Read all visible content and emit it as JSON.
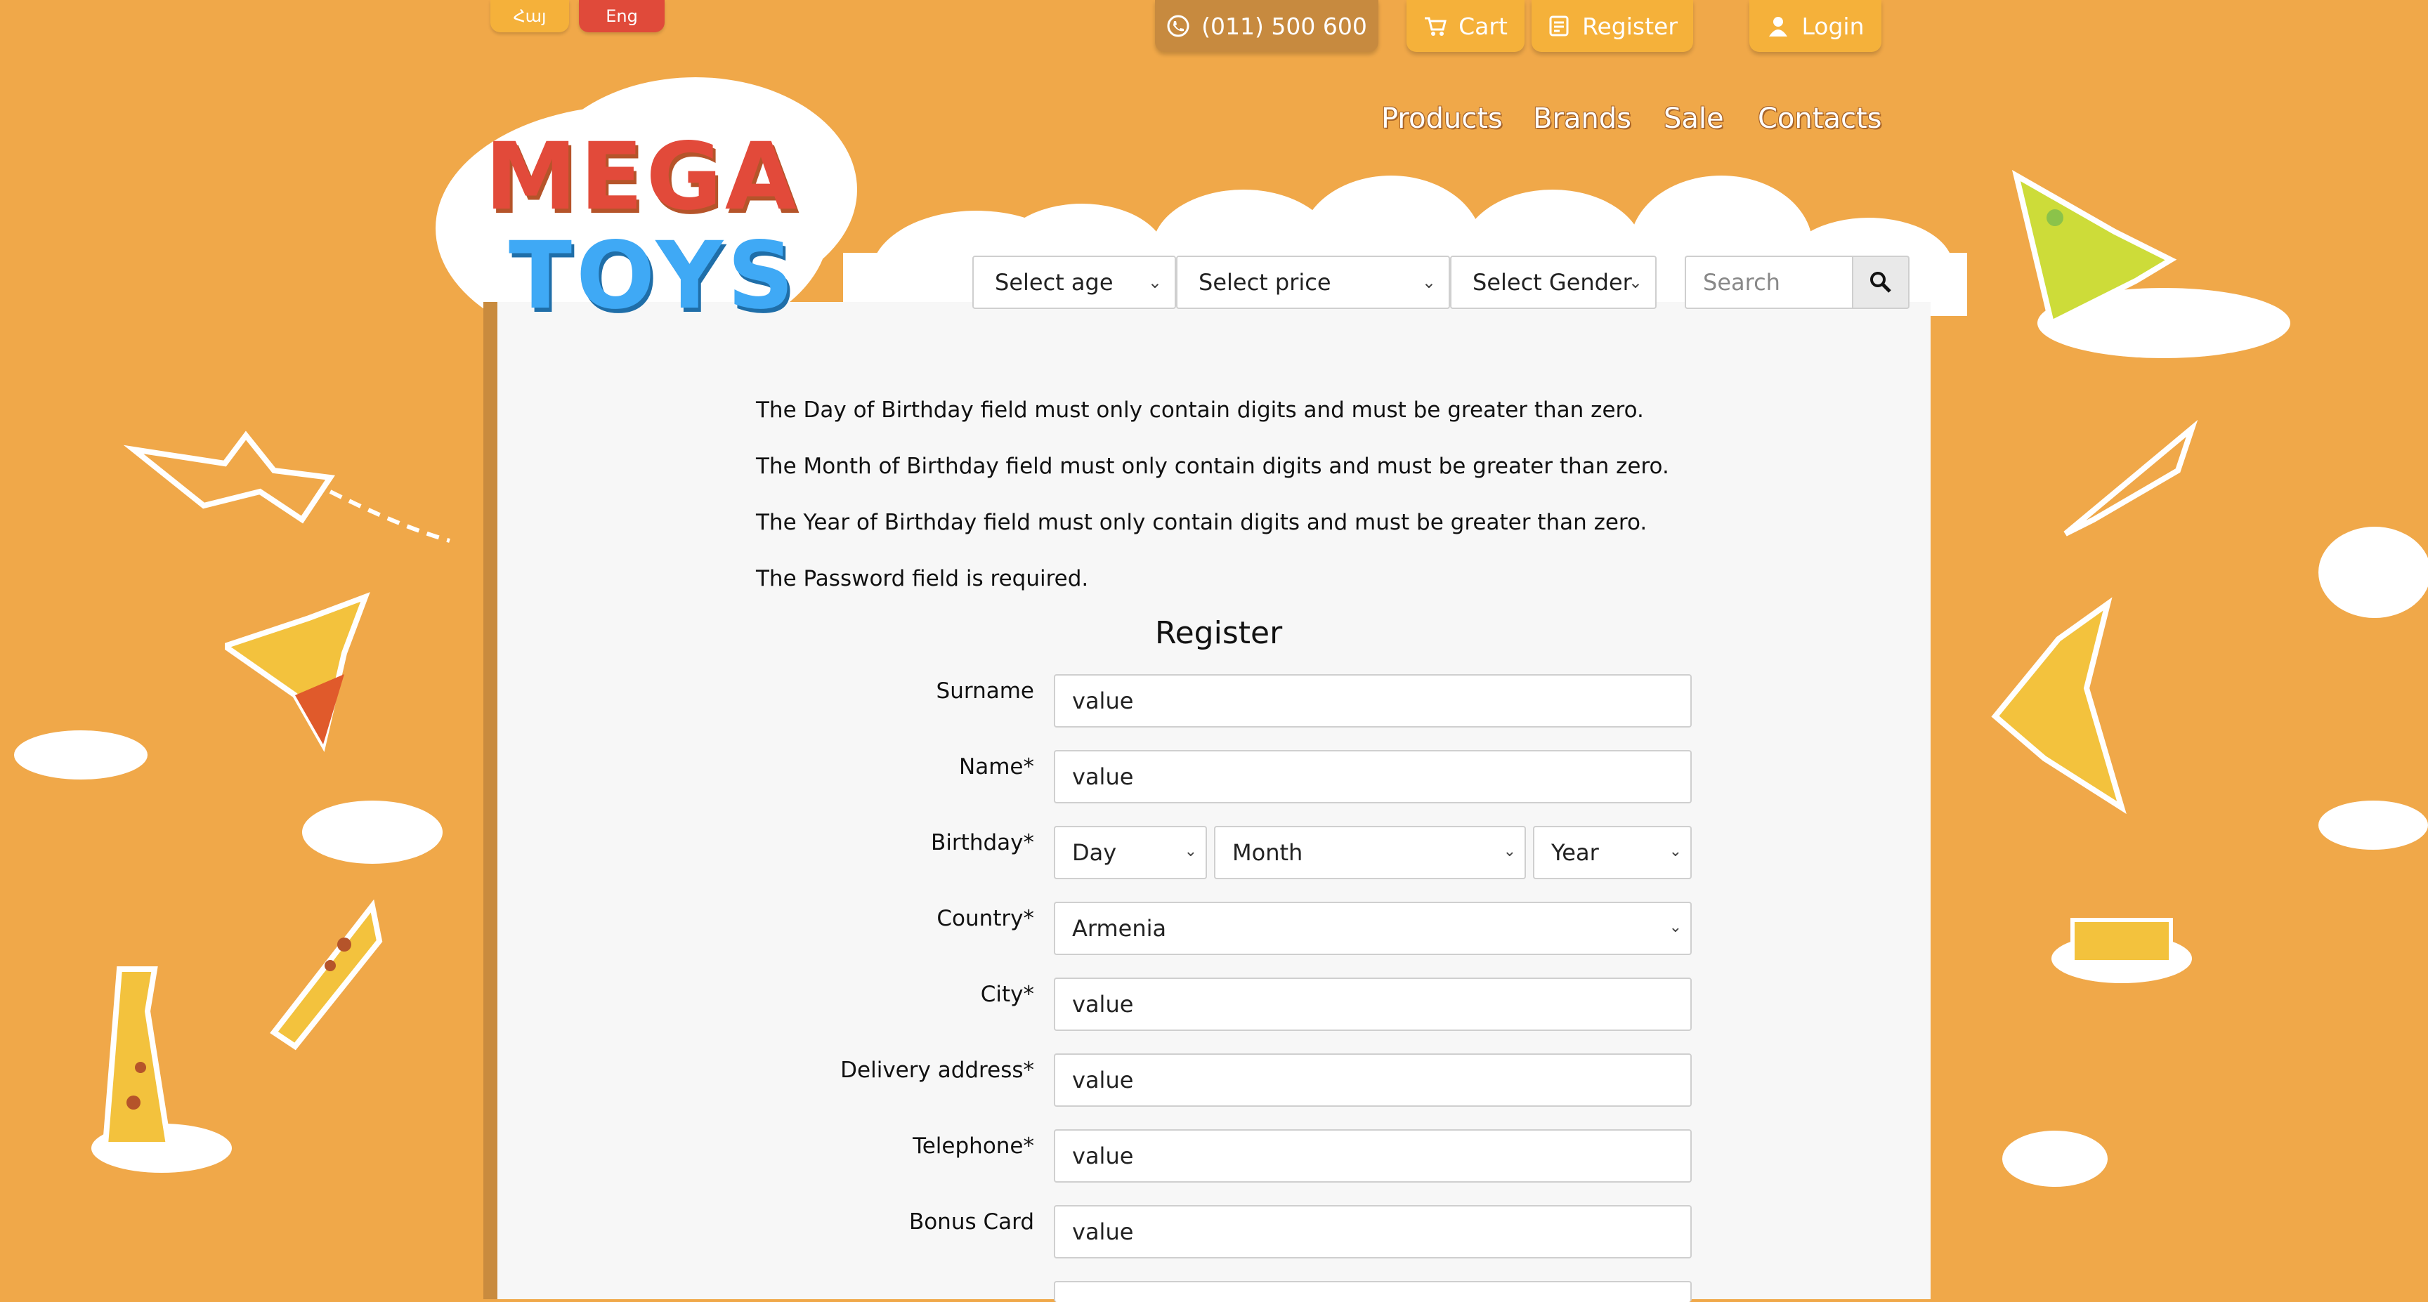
{
  "header": {
    "languages": [
      "Հայ",
      "Eng"
    ],
    "phone": "(011) 500 600",
    "cart_label": "Cart",
    "register_label": "Register",
    "login_label": "Login",
    "nav": [
      "Products",
      "Brands",
      "Sale",
      "Contacts"
    ],
    "logo_line1": "MEGA",
    "logo_line2": "TOYS"
  },
  "filters": {
    "age": "Select age",
    "price": "Select price",
    "gender": "Select Gender",
    "search_placeholder": "Search"
  },
  "errors": [
    "The Day of Birthday field must only contain digits and must be greater than zero.",
    "The Month of Birthday field must only contain digits and must be greater than zero.",
    "The Year of Birthday field must only contain digits and must be greater than zero.",
    "The Password field is required."
  ],
  "form": {
    "title": "Register",
    "surname": {
      "label": "Surname",
      "value": "value"
    },
    "name": {
      "label": "Name*",
      "value": "value"
    },
    "birthday": {
      "label": "Birthday*",
      "day": "Day",
      "month": "Month",
      "year": "Year"
    },
    "country": {
      "label": "Country*",
      "value": "Armenia"
    },
    "city": {
      "label": "City*",
      "value": "value"
    },
    "delivery": {
      "label": "Delivery address*",
      "value": "value"
    },
    "telephone": {
      "label": "Telephone*",
      "value": "value"
    },
    "bonus": {
      "label": "Bonus Card",
      "value": "value"
    }
  },
  "colors": {
    "background": "#f0a849",
    "lang_armenian": "#f5b13a",
    "lang_english": "#e04a3a",
    "panel": "#f7f7f7"
  }
}
